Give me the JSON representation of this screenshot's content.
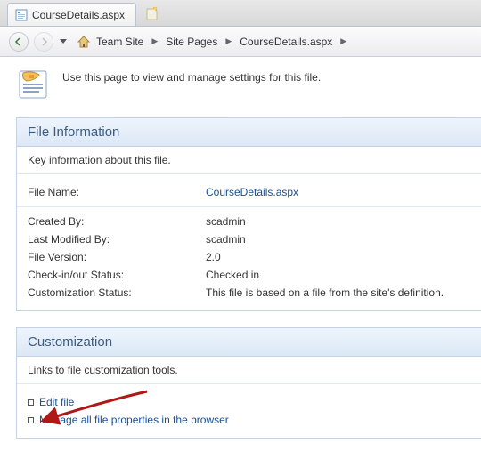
{
  "tab": {
    "title": "CourseDetails.aspx"
  },
  "breadcrumb": {
    "items": [
      "Team Site",
      "Site Pages",
      "CourseDetails.aspx"
    ]
  },
  "page": {
    "description": "Use this page to view and manage settings for this file."
  },
  "fileInfo": {
    "heading": "File Information",
    "desc": "Key information about this file.",
    "fileNameLabel": "File Name:",
    "fileNameValue": "CourseDetails.aspx",
    "createdByLabel": "Created By:",
    "createdByValue": "scadmin",
    "modifiedByLabel": "Last Modified By:",
    "modifiedByValue": "scadmin",
    "versionLabel": "File Version:",
    "versionValue": "2.0",
    "checkinLabel": "Check-in/out Status:",
    "checkinValue": "Checked in",
    "customLabel": "Customization Status:",
    "customValue": "This file is based on a file from the site's definition."
  },
  "customization": {
    "heading": "Customization",
    "desc": "Links to file customization tools.",
    "link1": "Edit file",
    "link2": "Manage all file properties in the browser"
  }
}
